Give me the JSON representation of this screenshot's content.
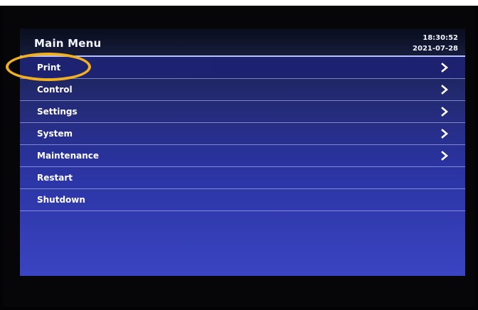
{
  "header": {
    "title": "Main Menu",
    "time": "18:30:52",
    "date": "2021-07-28"
  },
  "menu": {
    "items": [
      {
        "label": "Print",
        "has_submenu": true
      },
      {
        "label": "Control",
        "has_submenu": true
      },
      {
        "label": "Settings",
        "has_submenu": true
      },
      {
        "label": "System",
        "has_submenu": true
      },
      {
        "label": "Maintenance",
        "has_submenu": true
      },
      {
        "label": "Restart",
        "has_submenu": false
      },
      {
        "label": "Shutdown",
        "has_submenu": false
      }
    ]
  },
  "icons": {
    "submenu": "chevron-right-icon"
  },
  "colors": {
    "screen_background": "#2a33a0",
    "header_background": "#0e1228",
    "text": "#ffffff",
    "divider": "#b8c2ff",
    "annotation_highlight": "#f0b020"
  },
  "annotation": {
    "highlighted_item": "Print"
  }
}
